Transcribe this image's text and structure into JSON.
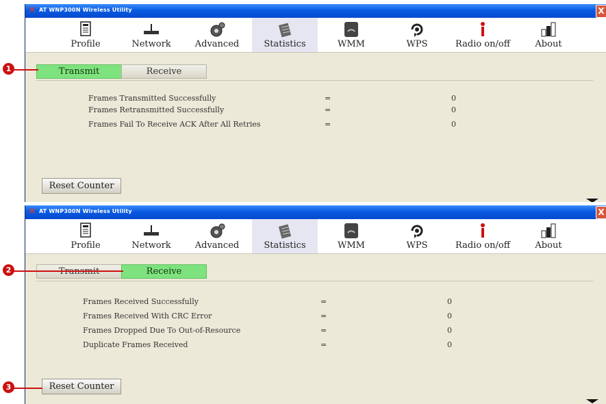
{
  "window": {
    "title": "AT WNP300N Wireless Utility",
    "close_glyph": "X"
  },
  "toolbar": [
    {
      "label": "Profile",
      "icon": "profile-icon"
    },
    {
      "label": "Network",
      "icon": "network-icon"
    },
    {
      "label": "Advanced",
      "icon": "advanced-icon"
    },
    {
      "label": "Statistics",
      "icon": "statistics-icon"
    },
    {
      "label": "WMM",
      "icon": "wmm-icon"
    },
    {
      "label": "WPS",
      "icon": "wps-icon"
    },
    {
      "label": "Radio on/off",
      "icon": "radio-icon"
    },
    {
      "label": "About",
      "icon": "about-icon"
    }
  ],
  "tabs": {
    "transmit": "Transmit",
    "receive": "Receive"
  },
  "transmit_stats": [
    {
      "label": "Frames Transmitted Successfully",
      "eq": "=",
      "value": "0"
    },
    {
      "label": "Frames Retransmitted Successfully",
      "eq": "=",
      "value": "0"
    },
    {
      "label": "Frames Fail To Receive ACK After All Retries",
      "eq": "=",
      "value": "0"
    }
  ],
  "receive_stats": [
    {
      "label": "Frames Received Successfully",
      "eq": "=",
      "value": "0"
    },
    {
      "label": "Frames Received With CRC Error",
      "eq": "=",
      "value": "0"
    },
    {
      "label": "Frames Dropped Due To Out-of-Resource",
      "eq": "=",
      "value": "0"
    },
    {
      "label": "Duplicate Frames Received",
      "eq": "=",
      "value": "0"
    }
  ],
  "reset_label": "Reset Counter",
  "callouts": [
    "1",
    "2",
    "3"
  ],
  "colors": {
    "title_bar": "#0a5be0",
    "active_tab": "#7ee37e",
    "callout": "#cc1111",
    "background": "#ece9d8"
  }
}
